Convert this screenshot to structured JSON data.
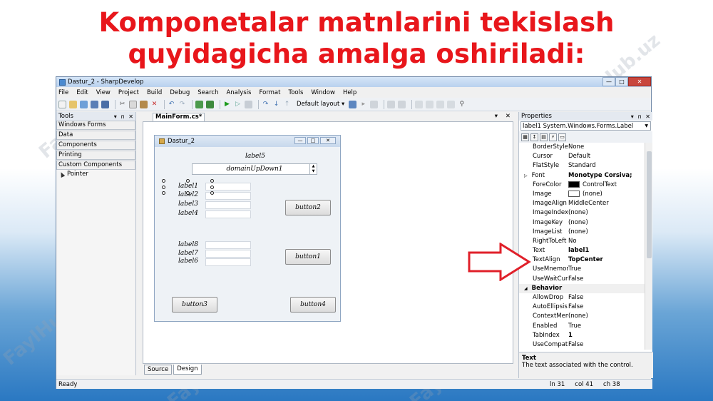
{
  "slide": {
    "title_line1": "Komponetalar matnlarini tekislash",
    "title_line2": "quyidagicha amalga oshiriladi:",
    "watermark": "FaylHub.uz"
  },
  "window": {
    "title": "Dastur_2 - SharpDevelop",
    "minimize_glyph": "—",
    "maximize_glyph": "□",
    "close_glyph": "✕"
  },
  "menu": [
    "File",
    "Edit",
    "View",
    "Project",
    "Build",
    "Debug",
    "Search",
    "Analysis",
    "Format",
    "Tools",
    "Window",
    "Help"
  ],
  "toolbar": {
    "layout_label": "Default layout ▾"
  },
  "tools_panel": {
    "title": "Tools",
    "ctrl_dropdown": "▾",
    "ctrl_pin": "ᴨ",
    "ctrl_close": "✕",
    "categories": [
      "Windows Forms",
      "Data",
      "Components",
      "Printing",
      "Custom Components"
    ],
    "pointer_label": "Pointer"
  },
  "document": {
    "tab_label": "MainForm.cs*",
    "ctrl_dropdown": "▾",
    "ctrl_close": "✕",
    "bottom_tabs": [
      "Source",
      "Design"
    ]
  },
  "form": {
    "title": "Dastur_2",
    "label5": "label5",
    "updown_text": "domainUpDown1",
    "updown_up": "▲",
    "updown_down": "▼",
    "labels_group1": [
      "label1",
      "label2",
      "label3",
      "label4"
    ],
    "labels_group2": [
      "label8",
      "label7",
      "label6"
    ],
    "button2": "button2",
    "button1": "button1",
    "button3": "button3",
    "button4": "button4"
  },
  "properties": {
    "title": "Properties",
    "ctrl_dropdown": "▾",
    "ctrl_pin": "ᴨ",
    "ctrl_close": "✕",
    "component": "label1  System.Windows.Forms.Label",
    "rows": [
      {
        "name": "BorderStyle",
        "value": "None"
      },
      {
        "name": "Cursor",
        "value": "Default"
      },
      {
        "name": "FlatStyle",
        "value": "Standard"
      },
      {
        "name": "Font",
        "value": "Monotype Corsiva;"
      },
      {
        "name": "ForeColor",
        "value": "ControlText"
      },
      {
        "name": "Image",
        "value": "(none)"
      },
      {
        "name": "ImageAlign",
        "value": "MiddleCenter"
      },
      {
        "name": "ImageIndex",
        "value": "(none)"
      },
      {
        "name": "ImageKey",
        "value": "(none)"
      },
      {
        "name": "ImageList",
        "value": "(none)"
      },
      {
        "name": "RightToLeft",
        "value": "No"
      },
      {
        "name": "Text",
        "value": "label1"
      },
      {
        "name": "TextAlign",
        "value": "TopCenter"
      },
      {
        "name": "UseMnemonic",
        "value": "True"
      },
      {
        "name": "UseWaitCursor",
        "value": "False"
      }
    ],
    "category_behavior": "Behavior",
    "behavior_rows": [
      {
        "name": "AllowDrop",
        "value": "False"
      },
      {
        "name": "AutoEllipsis",
        "value": "False"
      },
      {
        "name": "ContextMenuSt",
        "value": "(none)"
      },
      {
        "name": "Enabled",
        "value": "True"
      },
      {
        "name": "TabIndex",
        "value": "1"
      },
      {
        "name": "UseCompatible",
        "value": "False"
      }
    ],
    "desc_title": "Text",
    "desc_text": "The text associated with the control."
  },
  "status": {
    "left": "Ready",
    "line": "ln 31",
    "col": "col 41",
    "ch": "ch 38"
  },
  "colors": {
    "title_red": "#e8161b",
    "arrow_red": "#e0202a"
  }
}
